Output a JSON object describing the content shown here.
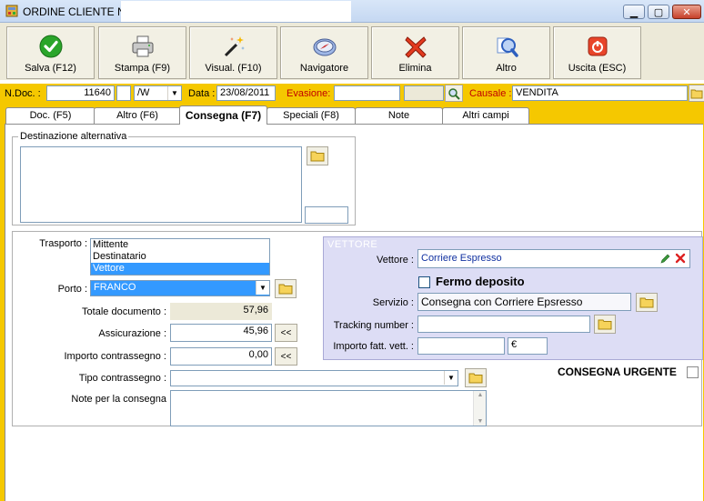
{
  "window": {
    "title": "ORDINE CLIENTE N."
  },
  "toolbar": {
    "buttons": [
      {
        "label": "Salva (F12)",
        "icon": "checkmark-icon"
      },
      {
        "label": "Stampa (F9)",
        "icon": "printer-icon"
      },
      {
        "label": "Visual. (F10)",
        "icon": "magic-wand-icon"
      },
      {
        "label": "Navigatore",
        "icon": "compass-icon"
      },
      {
        "label": "Elimina",
        "icon": "delete-x-icon"
      },
      {
        "label": "Altro",
        "icon": "magnifier-icon"
      },
      {
        "label": "Uscita (ESC)",
        "icon": "power-icon"
      }
    ]
  },
  "header": {
    "ndoc_label": "N.Doc. :",
    "ndoc_value": "11640",
    "series_value": "/W",
    "data_label": "Data :",
    "data_value": "23/08/2011",
    "evasione_label": "Evasione:",
    "evasione_value": "",
    "causale_label": "Causale :",
    "causale_value": "VENDITA"
  },
  "tabs": [
    {
      "label": "Doc. (F5)"
    },
    {
      "label": "Altro (F6)"
    },
    {
      "label": "Consegna (F7)",
      "active": true
    },
    {
      "label": "Speciali (F8)"
    },
    {
      "label": "Note"
    },
    {
      "label": "Altri campi"
    }
  ],
  "destinazione": {
    "legend": "Destinazione alternativa",
    "value": ""
  },
  "trasporto": {
    "label": "Trasporto :",
    "options": [
      "Mittente",
      "Destinatario",
      "Vettore"
    ],
    "selected": "Vettore"
  },
  "porto": {
    "label": "Porto :",
    "value": "FRANCO"
  },
  "totale_documento": {
    "label": "Totale documento :",
    "value": "57,96"
  },
  "assicurazione": {
    "label": "Assicurazione :",
    "value": "45,96",
    "button": "<<"
  },
  "importo_contrassegno": {
    "label": "Importo contrassegno :",
    "value": "0,00",
    "button": "<<"
  },
  "tipo_contrassegno": {
    "label": "Tipo contrassegno :",
    "value": ""
  },
  "note_consegna": {
    "label": "Note per la consegna",
    "value": ""
  },
  "vettore": {
    "legend": "VETTORE",
    "vettore_label": "Vettore :",
    "vettore_value": "Corriere Espresso",
    "fermo_deposito_label": "Fermo deposito",
    "servizio_label": "Servizio :",
    "servizio_value": "Consegna con Corriere Epsresso",
    "tracking_label": "Tracking number :",
    "tracking_value": "",
    "importo_label": "Importo fatt. vett. :",
    "importo_value": "",
    "currency": "€"
  },
  "consegna_urgente": {
    "label": "CONSEGNA URGENTE"
  },
  "colors": {
    "accent_yellow": "#f5c800",
    "selection_blue": "#3399ff",
    "vettore_bg": "#ddddf5"
  }
}
